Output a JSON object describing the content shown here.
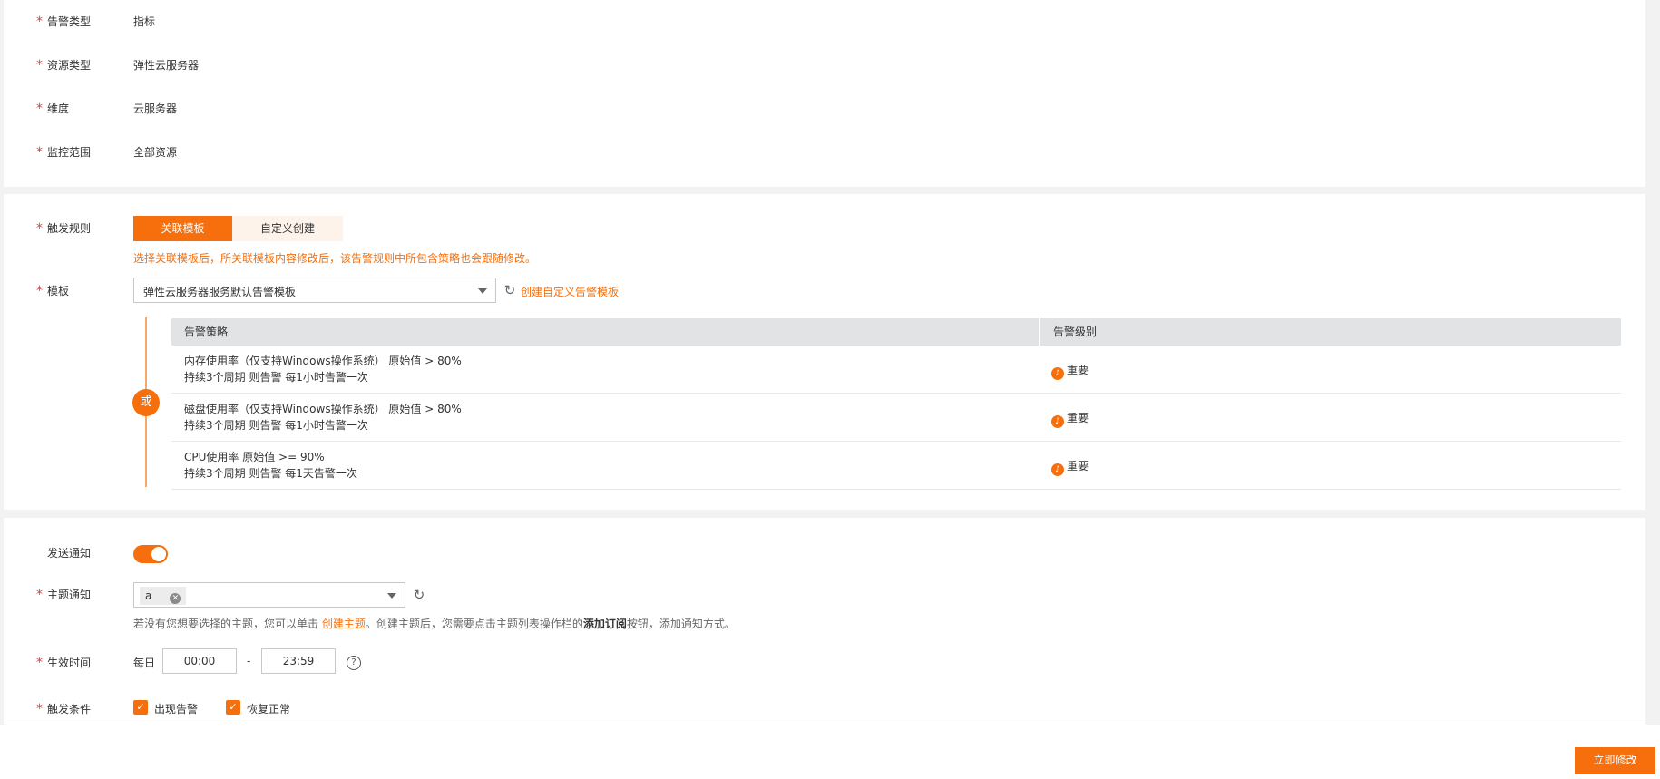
{
  "basic": {
    "alarm_type_label": "告警类型",
    "alarm_type_value": "指标",
    "resource_type_label": "资源类型",
    "resource_type_value": "弹性云服务器",
    "dimension_label": "维度",
    "dimension_value": "云服务器",
    "scope_label": "监控范围",
    "scope_value": "全部资源"
  },
  "trigger": {
    "rule_label": "触发规则",
    "tabs": [
      "关联模板",
      "自定义创建"
    ],
    "hint": "选择关联模板后，所关联模板内容修改后，该告警规则中所包含策略也会跟随修改。",
    "template_label": "模板",
    "template_value": "弹性云服务器服务默认告警模板",
    "create_template_link": "创建自定义告警模板",
    "or_label": "或",
    "table": {
      "headers": [
        "告警策略",
        "告警级别"
      ],
      "rows": [
        {
          "line1": "内存使用率（仅支持Windows操作系统） 原始值 > 80%",
          "line2": "持续3个周期 则告警 每1小时告警一次",
          "level": "重要"
        },
        {
          "line1": "磁盘使用率（仅支持Windows操作系统） 原始值 > 80%",
          "line2": "持续3个周期 则告警 每1小时告警一次",
          "level": "重要"
        },
        {
          "line1": "CPU使用率 原始值 >= 90%",
          "line2": "持续3个周期 则告警 每1天告警一次",
          "level": "重要"
        }
      ]
    }
  },
  "notify": {
    "send_label": "发送通知",
    "send_enabled": true,
    "topic_label": "主题通知",
    "topic_tag": "a",
    "hint_prefix": "若没有您想要选择的主题，您可以单击 ",
    "hint_link": "创建主题",
    "hint_middle": "。创建主题后，您需要点击主题列表操作栏的",
    "hint_bold": "添加订阅",
    "hint_suffix": "按钮，添加通知方式。",
    "effective_label": "生效时间",
    "daily": "每日",
    "start_time": "00:00",
    "dash": "-",
    "end_time": "23:59",
    "help_glyph": "?",
    "condition_label": "触发条件",
    "conditions": [
      "出现告警",
      "恢复正常"
    ]
  },
  "footer": {
    "submit_label": "立即修改"
  },
  "colors": {
    "accent": "#f66f0c",
    "required": "#e4393c"
  },
  "icons": {
    "refresh": "refresh-icon",
    "caret": "chevron-down-icon",
    "bell": "bell-icon",
    "check": "check-icon",
    "close": "close-icon",
    "help": "help-icon"
  }
}
